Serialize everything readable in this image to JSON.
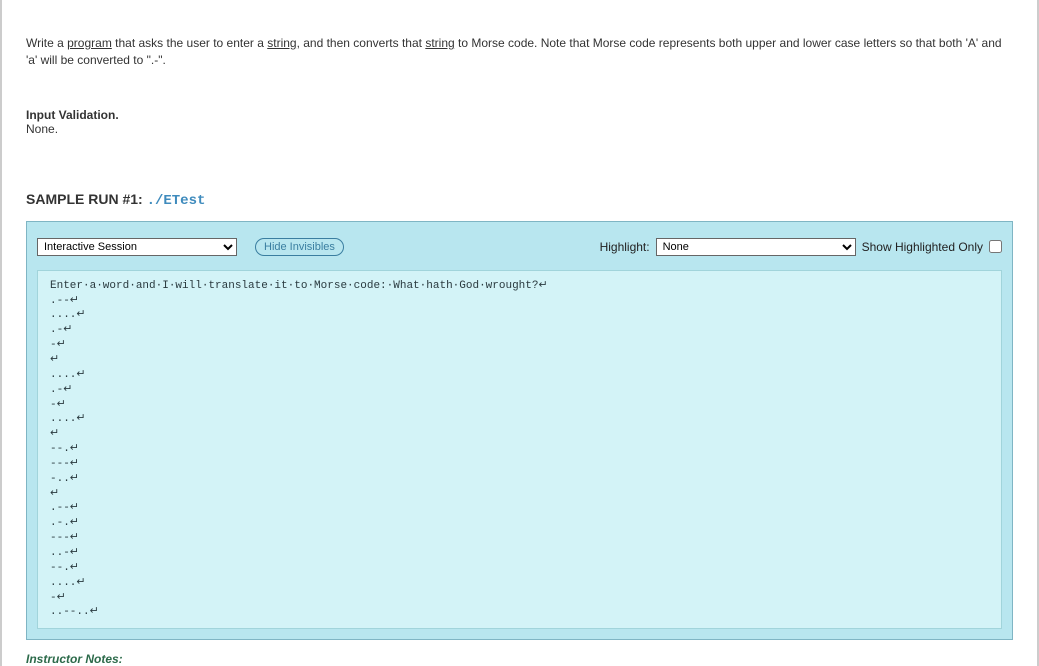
{
  "problem": {
    "text_before_prog": "Write a ",
    "prog_word": "program",
    "text_mid1": " that asks the user to enter a ",
    "string_word1": "string",
    "text_mid2": ", and then converts that ",
    "string_word2": "string",
    "text_after": " to Morse code. Note that Morse code represents both upper and lower case letters so that both 'A' and 'a' will be converted to \".-\"."
  },
  "validation": {
    "heading": "Input Validation.",
    "body": "None."
  },
  "sample": {
    "label": "SAMPLE RUN #1: ",
    "cmd": "./ETest"
  },
  "toolbar": {
    "session_selected": "Interactive Session",
    "hide_invisibles": "Hide Invisibles",
    "highlight_label": "Highlight:",
    "highlight_selected": "None",
    "show_highlighted": "Show Highlighted Only"
  },
  "terminal_lines": [
    "Enter·a·word·and·I·will·translate·it·to·Morse·code:·What·hath·God·wrought?↵",
    ".--↵",
    "....↵",
    ".-↵",
    "-↵",
    "↵",
    "....↵",
    ".-↵",
    "-↵",
    "....↵",
    "↵",
    "--.↵",
    "---↵",
    "-..↵",
    "↵",
    ".--↵",
    ".-.↵",
    "---↵",
    "..-↵",
    "--.↵",
    "....↵",
    "-↵",
    "..--..↵"
  ],
  "instructor": "Instructor Notes:"
}
